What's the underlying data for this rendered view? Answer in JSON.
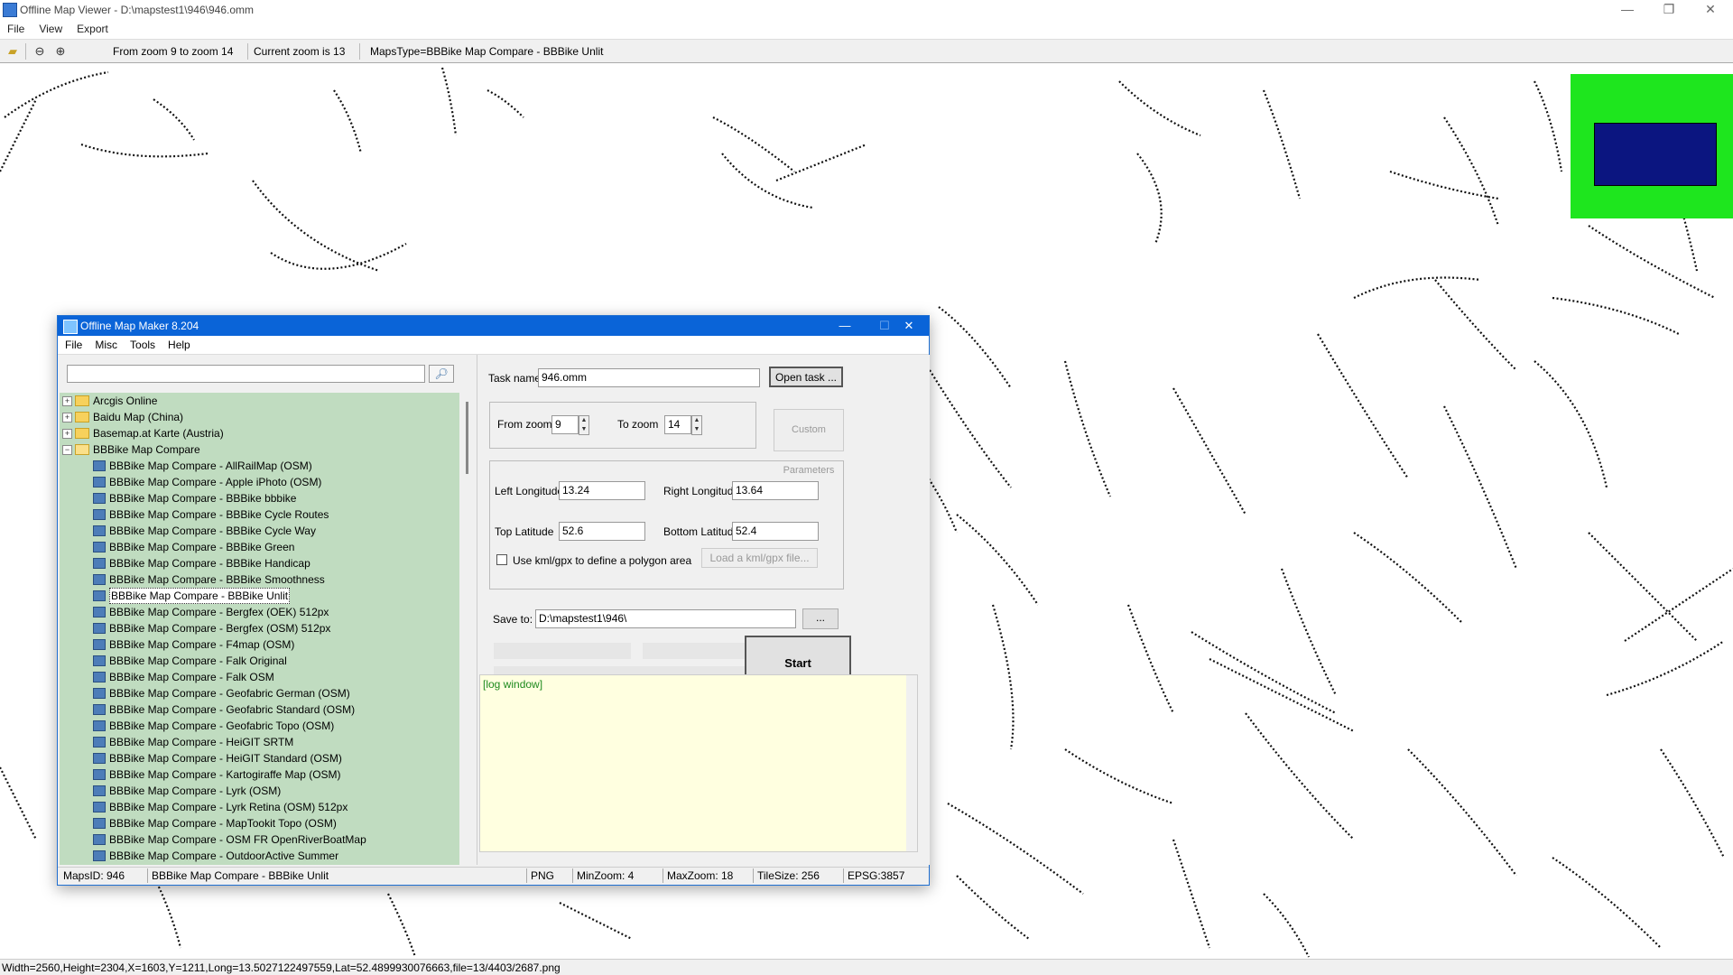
{
  "viewer": {
    "title": "Offline Map Viewer - D:\\mapstest1\\946\\946.omm",
    "menu": [
      "File",
      "View",
      "Export"
    ],
    "toolbar": {
      "zoom_range": "From zoom 9 to zoom 14",
      "current_zoom": "Current zoom is 13",
      "maps_type": "MapsType=BBBike Map Compare - BBBike Unlit"
    },
    "status": "Width=2560,Height=2304,X=1603,Y=1211,Long=13.5027122497559,Lat=52.4899930076663,file=13/4403/2687.png",
    "minimap_colors": {
      "background": "#1ee61e",
      "viewport": "#0b1580"
    }
  },
  "maker": {
    "title": "Offline Map Maker 8.204",
    "menu": [
      "File",
      "Misc",
      "Tools",
      "Help"
    ],
    "search": {
      "value": "",
      "placeholder": ""
    },
    "tree": {
      "folders": [
        "Arcgis Online",
        "Baidu Map (China)",
        "Basemap.at Karte (Austria)",
        "BBBike Map Compare"
      ],
      "items": [
        "BBBike Map Compare - AllRailMap (OSM)",
        "BBBike Map Compare - Apple iPhoto (OSM)",
        "BBBike Map Compare - BBBike bbbike",
        "BBBike Map Compare - BBBike Cycle Routes",
        "BBBike Map Compare - BBBike Cycle Way",
        "BBBike Map Compare - BBBike Green",
        "BBBike Map Compare - BBBike Handicap",
        "BBBike Map Compare - BBBike Smoothness",
        "BBBike Map Compare - BBBike Unlit",
        "BBBike Map Compare - Bergfex (OEK) 512px",
        "BBBike Map Compare - Bergfex (OSM) 512px",
        "BBBike Map Compare - F4map (OSM)",
        "BBBike Map Compare - Falk Original",
        "BBBike Map Compare - Falk OSM",
        "BBBike Map Compare - Geofabric German (OSM)",
        "BBBike Map Compare - Geofabric Standard (OSM)",
        "BBBike Map Compare - Geofabric Topo (OSM)",
        "BBBike Map Compare - HeiGIT SRTM",
        "BBBike Map Compare - HeiGIT Standard (OSM)",
        "BBBike Map Compare - Kartogiraffe Map (OSM)",
        "BBBike Map Compare - Lyrk (OSM)",
        "BBBike Map Compare - Lyrk Retina (OSM) 512px",
        "BBBike Map Compare - MapTookit Topo (OSM)",
        "BBBike Map Compare - OSM FR OpenRiverBoatMap",
        "BBBike Map Compare - OutdoorActive Summer"
      ],
      "selected_index": 8
    },
    "form": {
      "task_label": "Task name",
      "task_value": "946.omm",
      "open_task": "Open task ...",
      "from_zoom_label": "From zoom",
      "from_zoom": "9",
      "to_zoom_label": "To zoom",
      "to_zoom": "14",
      "custom_params": "Custom Parameters",
      "left_lon_label": "Left Longitude",
      "left_lon": "13.24",
      "right_lon_label": "Right Longitude",
      "right_lon": "13.64",
      "top_lat_label": "Top Latitude",
      "top_lat": "52.6",
      "bottom_lat_label": "Bottom Latitude",
      "bottom_lat": "52.4",
      "kml_label": "Use kml/gpx to define a polygon area",
      "load_kml": "Load a kml/gpx file...",
      "save_label": "Save to:",
      "save_value": "D:\\mapstest1\\946\\",
      "browse": "...",
      "start": "Start",
      "log": "[log window]"
    },
    "status": {
      "maps_id": "MapsID: 946",
      "name": "BBBike Map Compare - BBBike Unlit",
      "format": "PNG",
      "min_zoom": "MinZoom: 4",
      "max_zoom": "MaxZoom: 18",
      "tile_size": "TileSize: 256",
      "epsg": "EPSG:3857"
    }
  }
}
